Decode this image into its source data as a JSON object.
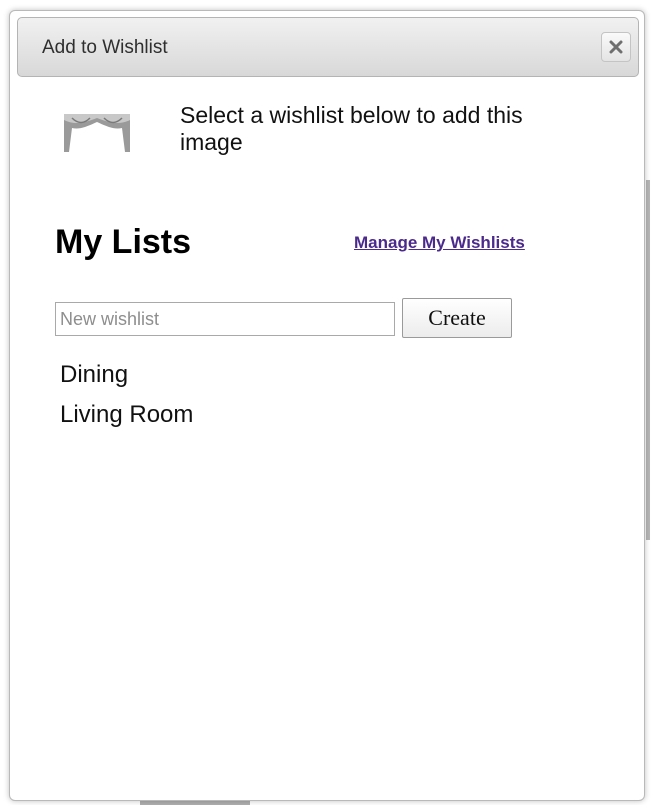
{
  "dialog": {
    "title": "Add to Wishlist",
    "close_icon": "close-icon",
    "instruction": "Select a wishlist below to add this image",
    "thumbnail_icon": "curtain-image-thumbnail"
  },
  "lists_section": {
    "heading": "My Lists",
    "manage_link": "Manage My Wishlists",
    "new_wishlist": {
      "placeholder": "New wishlist",
      "value": ""
    },
    "create_label": "Create",
    "items": [
      {
        "label": "Dining"
      },
      {
        "label": "Living Room"
      }
    ]
  },
  "colors": {
    "link": "#4b2a8c",
    "titlebar_top": "#f1f1f1",
    "titlebar_bottom": "#d8d8d8",
    "border": "#b9b9b9"
  }
}
